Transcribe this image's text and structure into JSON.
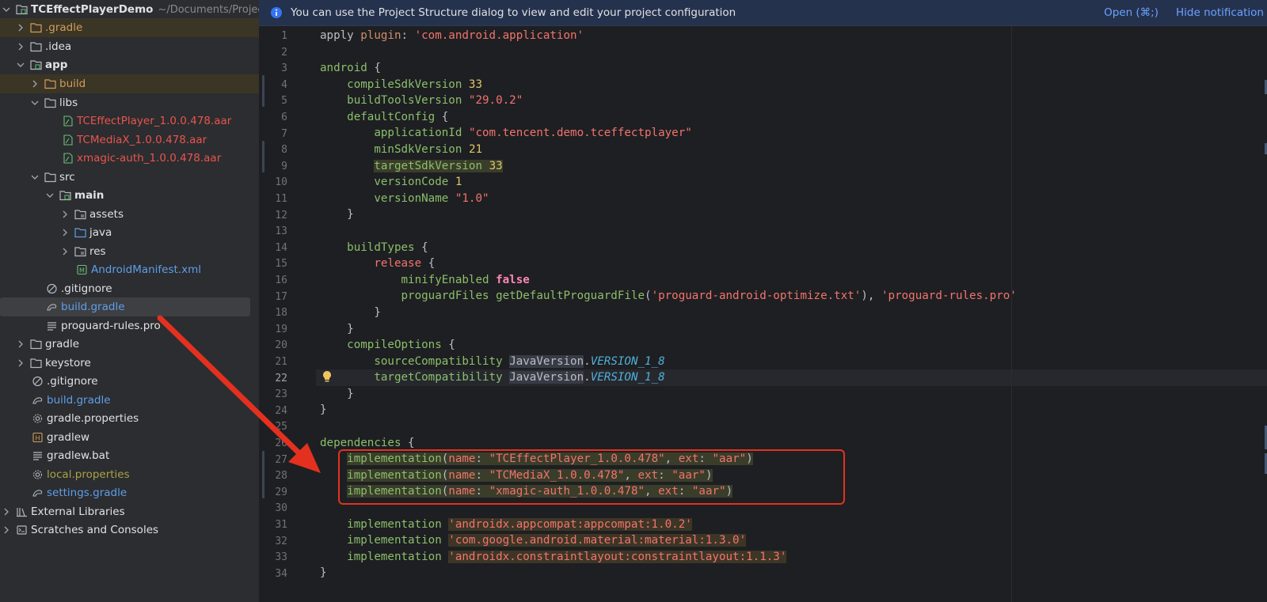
{
  "project_tree": {
    "root_name": "TCEffectPlayerDemo",
    "root_path": "~/Documents/Project",
    "items": [
      {
        "label": ".gradle"
      },
      {
        "label": ".idea"
      },
      {
        "label": "app"
      },
      {
        "label": "build"
      },
      {
        "label": "libs"
      },
      {
        "label": "TCEffectPlayer_1.0.0.478.aar"
      },
      {
        "label": "TCMediaX_1.0.0.478.aar"
      },
      {
        "label": "xmagic-auth_1.0.0.478.aar"
      },
      {
        "label": "src"
      },
      {
        "label": "main"
      },
      {
        "label": "assets"
      },
      {
        "label": "java"
      },
      {
        "label": "res"
      },
      {
        "label": "AndroidManifest.xml"
      },
      {
        "label": ".gitignore"
      },
      {
        "label": "build.gradle"
      },
      {
        "label": "proguard-rules.pro"
      },
      {
        "label": "gradle"
      },
      {
        "label": "keystore"
      },
      {
        "label": ".gitignore"
      },
      {
        "label": "build.gradle"
      },
      {
        "label": "gradle.properties"
      },
      {
        "label": "gradlew"
      },
      {
        "label": "gradlew.bat"
      },
      {
        "label": "local.properties"
      },
      {
        "label": "settings.gradle"
      },
      {
        "label": "External Libraries"
      },
      {
        "label": "Scratches and Consoles"
      }
    ]
  },
  "notification": {
    "message": "You can use the Project Structure dialog to view and edit your project configuration",
    "open_label": "Open (⌘;)",
    "hide_label": "Hide notification"
  },
  "editor": {
    "current_line": 22,
    "line_numbers": [
      "1",
      "2",
      "3",
      "4",
      "5",
      "6",
      "7",
      "8",
      "9",
      "10",
      "11",
      "12",
      "13",
      "14",
      "15",
      "16",
      "17",
      "18",
      "19",
      "20",
      "21",
      "22",
      "23",
      "24",
      "25",
      "26",
      "27",
      "28",
      "29",
      "30",
      "31",
      "32",
      "33",
      "34"
    ],
    "code": {
      "l1_a": "apply ",
      "l1_b": "plugin",
      "l1_c": ": ",
      "l1_d": "'com.android.application'",
      "l3_a": "android ",
      "l3_b": "{",
      "l4_a": "compileSdkVersion ",
      "l4_b": "33",
      "l5_a": "buildToolsVersion ",
      "l5_b": "\"29.0.2\"",
      "l6_a": "defaultConfig ",
      "l6_b": "{",
      "l7_a": "applicationId ",
      "l7_b": "\"com.tencent.demo.tceffectplayer\"",
      "l8_a": "minSdkVersion ",
      "l8_b": "21",
      "l9_a": "targetSdkVersion ",
      "l9_b": "33",
      "l10_a": "versionCode ",
      "l10_b": "1",
      "l11_a": "versionName ",
      "l11_b": "\"1.0\"",
      "l12": "}",
      "l14_a": "buildTypes ",
      "l14_b": "{",
      "l15_a": "release ",
      "l15_b": "{",
      "l16_a": "minifyEnabled ",
      "l16_b": "false",
      "l17_a": "proguardFiles ",
      "l17_b": "getDefaultProguardFile",
      "l17_c": "(",
      "l17_d": "'proguard-android-optimize.txt'",
      "l17_e": "), ",
      "l17_f": "'proguard-rules.pro'",
      "l18": "}",
      "l19": "}",
      "l20_a": "compileOptions ",
      "l20_b": "{",
      "l21_a": "sourceCompatibility ",
      "l21_b": "JavaVersion",
      "l21_c": ".",
      "l21_d": "VERSION_1_8",
      "l22_a": "targetCompatibility ",
      "l22_b": "JavaVersion",
      "l22_c": ".",
      "l22_d": "VERSION_1_8",
      "l23": "}",
      "l24": "}",
      "l26_a": "dependencies ",
      "l26_b": "{",
      "l27_a": "implementation",
      "l27_b": "(",
      "l27_c": "name",
      "l27_d": ": ",
      "l27_e": "\"TCEffectPlayer_1.0.0.478\"",
      "l27_f": ", ",
      "l27_g": "ext",
      "l27_h": ": ",
      "l27_i": "\"aar\"",
      "l27_j": ")",
      "l28_a": "implementation",
      "l28_b": "(",
      "l28_c": "name",
      "l28_d": ": ",
      "l28_e": "\"TCMediaX_1.0.0.478\"",
      "l28_f": ", ",
      "l28_g": "ext",
      "l28_h": ": ",
      "l28_i": "\"aar\"",
      "l28_j": ")",
      "l29_a": "implementation",
      "l29_b": "(",
      "l29_c": "name",
      "l29_d": ": ",
      "l29_e": "\"xmagic-auth_1.0.0.478\"",
      "l29_f": ", ",
      "l29_g": "ext",
      "l29_h": ": ",
      "l29_i": "\"aar\"",
      "l29_j": ")",
      "l31_a": "implementation ",
      "l31_b": "'androidx.appcompat:appcompat:1.0.2'",
      "l32_a": "implementation ",
      "l32_b": "'com.google.android.material:material:1.3.0'",
      "l33_a": "implementation ",
      "l33_b": "'androidx.constraintlayout:constraintlayout:1.1.3'",
      "l34": "}"
    }
  },
  "colors": {
    "annotation": "#e4311f",
    "accent_link": "#6aa1ff",
    "excluded_folder": "#d19d5b",
    "aar_file": "#e9544d"
  },
  "icons": [
    "folder-icon",
    "module-folder-icon",
    "aar-file-icon",
    "manifest-icon",
    "gitignore-icon",
    "gradle-file-icon",
    "text-file-icon",
    "settings-file-icon",
    "shell-icon",
    "library-icon",
    "scratches-icon",
    "info-icon",
    "lightbulb-icon",
    "chevron-right-icon",
    "chevron-down-icon"
  ]
}
